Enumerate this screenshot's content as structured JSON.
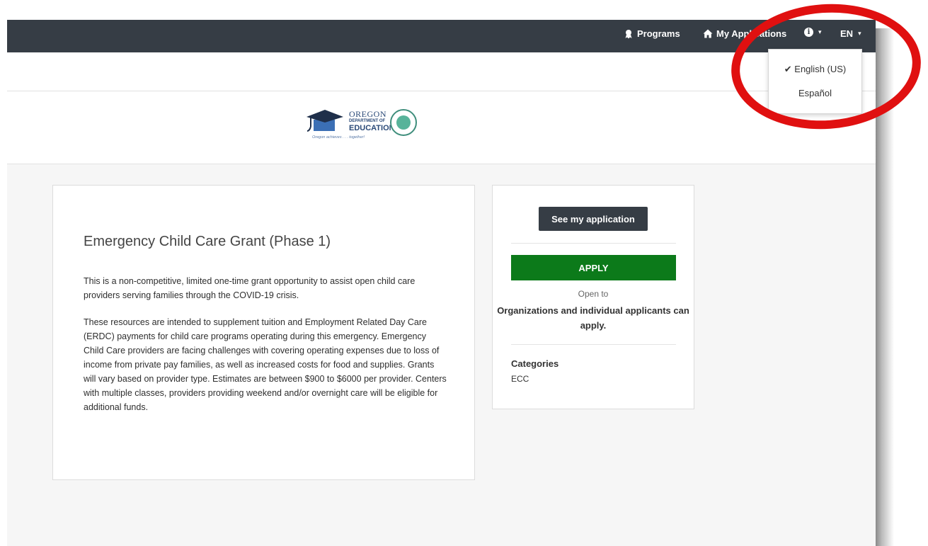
{
  "navbar": {
    "programs_label": "Programs",
    "my_applications_label": "My Applications",
    "info_label": "i",
    "language_label": "EN",
    "caret": "▾"
  },
  "language_menu": {
    "check": "✔",
    "options": [
      "English (US)",
      "Español"
    ]
  },
  "logo": {
    "line1": "OREGON",
    "line2": "DEPARTMENT OF",
    "line3": "EDUCATION",
    "tagline": "Oregon achieves . . . together!"
  },
  "grant": {
    "title": "Emergency Child Care Grant (Phase 1)",
    "paragraph1": "This is a non-competitive, limited one-time grant opportunity to assist open child care providers serving families through the COVID-19 crisis.",
    "paragraph2": "These resources are intended to supplement tuition and Employment Related Day Care (ERDC) payments for child care programs operating during this emergency. Emergency Child Care providers are facing challenges with covering operating expenses due to loss of income from private pay families, as well as increased costs for food and supplies. Grants will vary based on provider type. Estimates are between $900 to $6000 per provider. Centers with multiple classes, providers providing weekend and/or overnight care will be eligible for additional funds."
  },
  "sidebar": {
    "see_application_label": "See my application",
    "apply_label": "APPLY",
    "open_to_label": "Open to",
    "open_to_value": "Organizations and individual applicants can apply.",
    "categories_label": "Categories",
    "categories_value": "ECC"
  },
  "colors": {
    "navbar": "#363d45",
    "apply": "#0c7a1a",
    "highlight_ring": "#e01010"
  }
}
